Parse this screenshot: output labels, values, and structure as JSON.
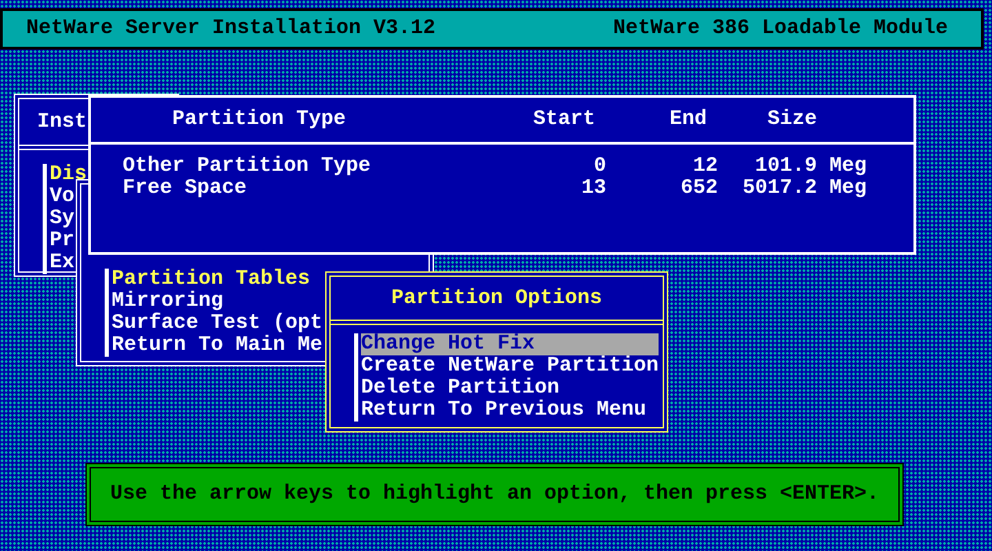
{
  "header": {
    "title": "NetWare Server Installation V3.12",
    "subtitle": "NetWare 386 Loadable Module"
  },
  "install_menu": {
    "title": "Inst",
    "items": [
      {
        "label": "Dis",
        "selected": true
      },
      {
        "label": "Vo",
        "selected": false
      },
      {
        "label": "Sy",
        "selected": false
      },
      {
        "label": "Pr",
        "selected": false
      },
      {
        "label": "Ex",
        "selected": false
      }
    ]
  },
  "disk_menu": {
    "items": [
      {
        "label": "Partition Tables",
        "selected": true
      },
      {
        "label": "Mirroring",
        "selected": false
      },
      {
        "label": "Surface Test (opt",
        "selected": false
      },
      {
        "label": "Return To Main Me",
        "selected": false
      }
    ]
  },
  "partition_table": {
    "columns": [
      "Partition Type",
      "Start",
      "End",
      "Size"
    ],
    "rows": [
      [
        "Other Partition Type",
        "0",
        "12",
        "101.9 Meg"
      ],
      [
        "Free Space",
        "13",
        "652",
        "5017.2 Meg"
      ]
    ]
  },
  "options": {
    "title": "Partition Options",
    "items": [
      {
        "label": "Change Hot Fix",
        "selected": true
      },
      {
        "label": "Create NetWare Partition",
        "selected": false
      },
      {
        "label": "Delete Partition",
        "selected": false
      },
      {
        "label": "Return To Previous Menu",
        "selected": false
      }
    ]
  },
  "status_bar": "Use the arrow keys to highlight an option, then press <ENTER>."
}
